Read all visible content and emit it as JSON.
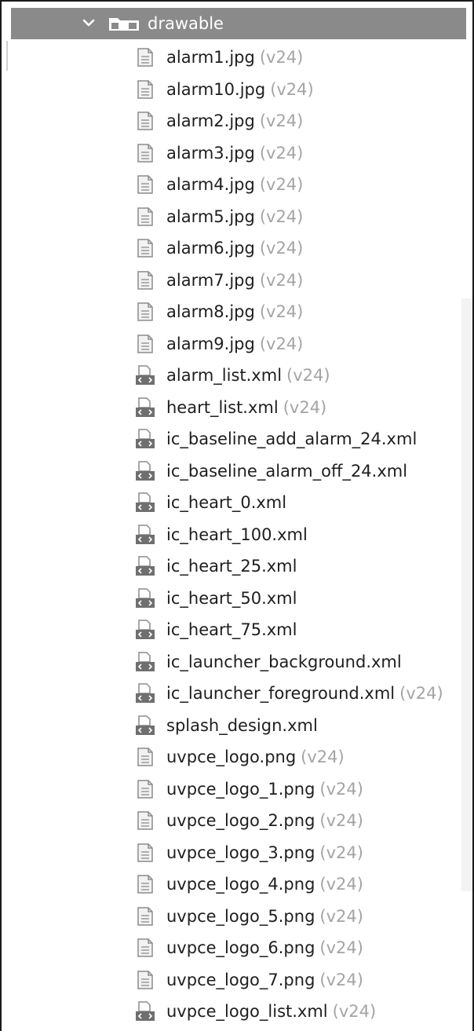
{
  "folder": {
    "name": "drawable",
    "expanded": true,
    "icon": "folder-icon"
  },
  "files": [
    {
      "name": "alarm1.jpg",
      "qualifier": "(v24)",
      "type": "image"
    },
    {
      "name": "alarm10.jpg",
      "qualifier": "(v24)",
      "type": "image"
    },
    {
      "name": "alarm2.jpg",
      "qualifier": "(v24)",
      "type": "image"
    },
    {
      "name": "alarm3.jpg",
      "qualifier": "(v24)",
      "type": "image"
    },
    {
      "name": "alarm4.jpg",
      "qualifier": "(v24)",
      "type": "image"
    },
    {
      "name": "alarm5.jpg",
      "qualifier": "(v24)",
      "type": "image"
    },
    {
      "name": "alarm6.jpg",
      "qualifier": "(v24)",
      "type": "image"
    },
    {
      "name": "alarm7.jpg",
      "qualifier": "(v24)",
      "type": "image"
    },
    {
      "name": "alarm8.jpg",
      "qualifier": "(v24)",
      "type": "image"
    },
    {
      "name": "alarm9.jpg",
      "qualifier": "(v24)",
      "type": "image"
    },
    {
      "name": "alarm_list.xml",
      "qualifier": "(v24)",
      "type": "xml"
    },
    {
      "name": "heart_list.xml",
      "qualifier": "(v24)",
      "type": "xml"
    },
    {
      "name": "ic_baseline_add_alarm_24.xml",
      "qualifier": "",
      "type": "xml"
    },
    {
      "name": "ic_baseline_alarm_off_24.xml",
      "qualifier": "",
      "type": "xml"
    },
    {
      "name": "ic_heart_0.xml",
      "qualifier": "",
      "type": "xml"
    },
    {
      "name": "ic_heart_100.xml",
      "qualifier": "",
      "type": "xml"
    },
    {
      "name": "ic_heart_25.xml",
      "qualifier": "",
      "type": "xml"
    },
    {
      "name": "ic_heart_50.xml",
      "qualifier": "",
      "type": "xml"
    },
    {
      "name": "ic_heart_75.xml",
      "qualifier": "",
      "type": "xml"
    },
    {
      "name": "ic_launcher_background.xml",
      "qualifier": "",
      "type": "xml"
    },
    {
      "name": "ic_launcher_foreground.xml",
      "qualifier": "(v24)",
      "type": "xml"
    },
    {
      "name": "splash_design.xml",
      "qualifier": "",
      "type": "xml"
    },
    {
      "name": "uvpce_logo.png",
      "qualifier": "(v24)",
      "type": "image"
    },
    {
      "name": "uvpce_logo_1.png",
      "qualifier": "(v24)",
      "type": "image"
    },
    {
      "name": "uvpce_logo_2.png",
      "qualifier": "(v24)",
      "type": "image"
    },
    {
      "name": "uvpce_logo_3.png",
      "qualifier": "(v24)",
      "type": "image"
    },
    {
      "name": "uvpce_logo_4.png",
      "qualifier": "(v24)",
      "type": "image"
    },
    {
      "name": "uvpce_logo_5.png",
      "qualifier": "(v24)",
      "type": "image"
    },
    {
      "name": "uvpce_logo_6.png",
      "qualifier": "(v24)",
      "type": "image"
    },
    {
      "name": "uvpce_logo_7.png",
      "qualifier": "(v24)",
      "type": "image"
    },
    {
      "name": "uvpce_logo_list.xml",
      "qualifier": "(v24)",
      "type": "xml"
    }
  ],
  "colors": {
    "selection_bg": "#8a8a8a",
    "text": "#1e1e1e",
    "qualifier": "#a4a4a4",
    "icon_gray": "#8c8c8c"
  }
}
